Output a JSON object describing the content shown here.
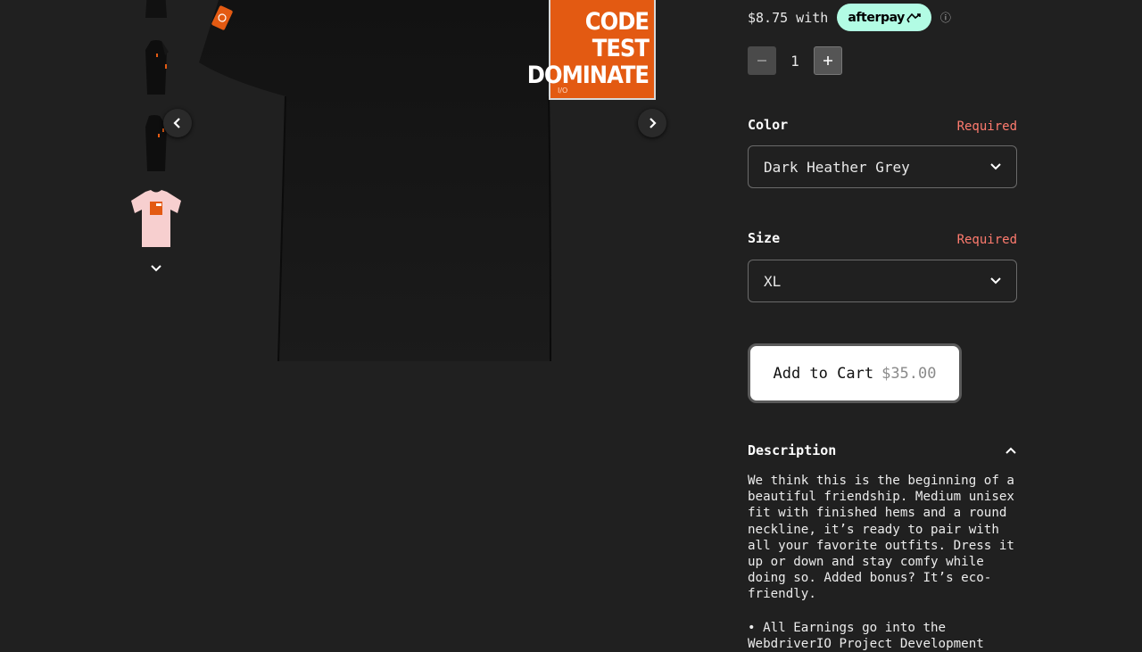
{
  "thumbnails": [
    {
      "name": "thumbnail-black-shirt-front",
      "variant": "black"
    },
    {
      "name": "thumbnail-black-shirt-side",
      "variant": "black"
    },
    {
      "name": "thumbnail-black-shirt-back",
      "variant": "black"
    },
    {
      "name": "thumbnail-pink-shirt-front",
      "variant": "pink"
    }
  ],
  "main_image": {
    "poster_lines": [
      "CODE",
      "TEST",
      "DOMINATE"
    ],
    "poster_mark": "I/O"
  },
  "afterpay": {
    "installment": "$8.75 with",
    "badge": "afterpay"
  },
  "quantity": {
    "value": "1"
  },
  "color": {
    "label": "Color",
    "required": "Required",
    "selected": "Dark Heather Grey"
  },
  "size": {
    "label": "Size",
    "required": "Required",
    "selected": "XL"
  },
  "cart": {
    "label": "Add to Cart",
    "price": "$35.00"
  },
  "description": {
    "heading": "Description",
    "body": "We think this is the beginning of a beautiful friendship. Medium unisex fit with finished hems and a round neckline, it’s ready to pair with all your favorite outfits. Dress it up or down and stay comfy while doing so. Added bonus? It’s eco-friendly.",
    "bullet": "• All Earnings go into the WebdriverIO Project Development"
  },
  "colors": {
    "background": "#202020",
    "accent_orange": "#e35a12",
    "afterpay_mint": "#b2fce4",
    "required_red": "#ff7b6e"
  }
}
